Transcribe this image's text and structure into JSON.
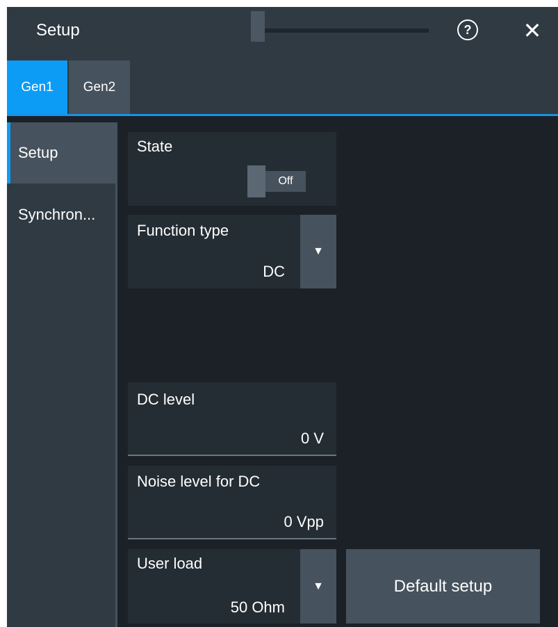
{
  "window": {
    "title": "Setup",
    "help_glyph": "?",
    "close_glyph": "✕"
  },
  "tabs": [
    {
      "label": "Gen1",
      "active": true
    },
    {
      "label": "Gen2",
      "active": false
    }
  ],
  "nav": {
    "items": [
      {
        "label": "Setup",
        "selected": true
      },
      {
        "label": "Synchron...",
        "selected": false
      }
    ]
  },
  "fields": {
    "state": {
      "label": "State",
      "toggle_value": "Off"
    },
    "function_type": {
      "label": "Function type",
      "value": "DC",
      "icon": "caret-down-icon"
    },
    "dc_level": {
      "label": "DC level",
      "value": "0 V"
    },
    "noise_level": {
      "label": "Noise level for DC",
      "value": "0 Vpp"
    },
    "user_load": {
      "label": "User load",
      "value": "50 Ohm",
      "icon": "caret-down-icon"
    }
  },
  "buttons": {
    "default_setup": "Default setup"
  },
  "colors": {
    "accent": "#0d9cf5",
    "background": "#1b2127",
    "panel": "#2f3a43",
    "field": "#252d34",
    "control": "#46525d"
  }
}
